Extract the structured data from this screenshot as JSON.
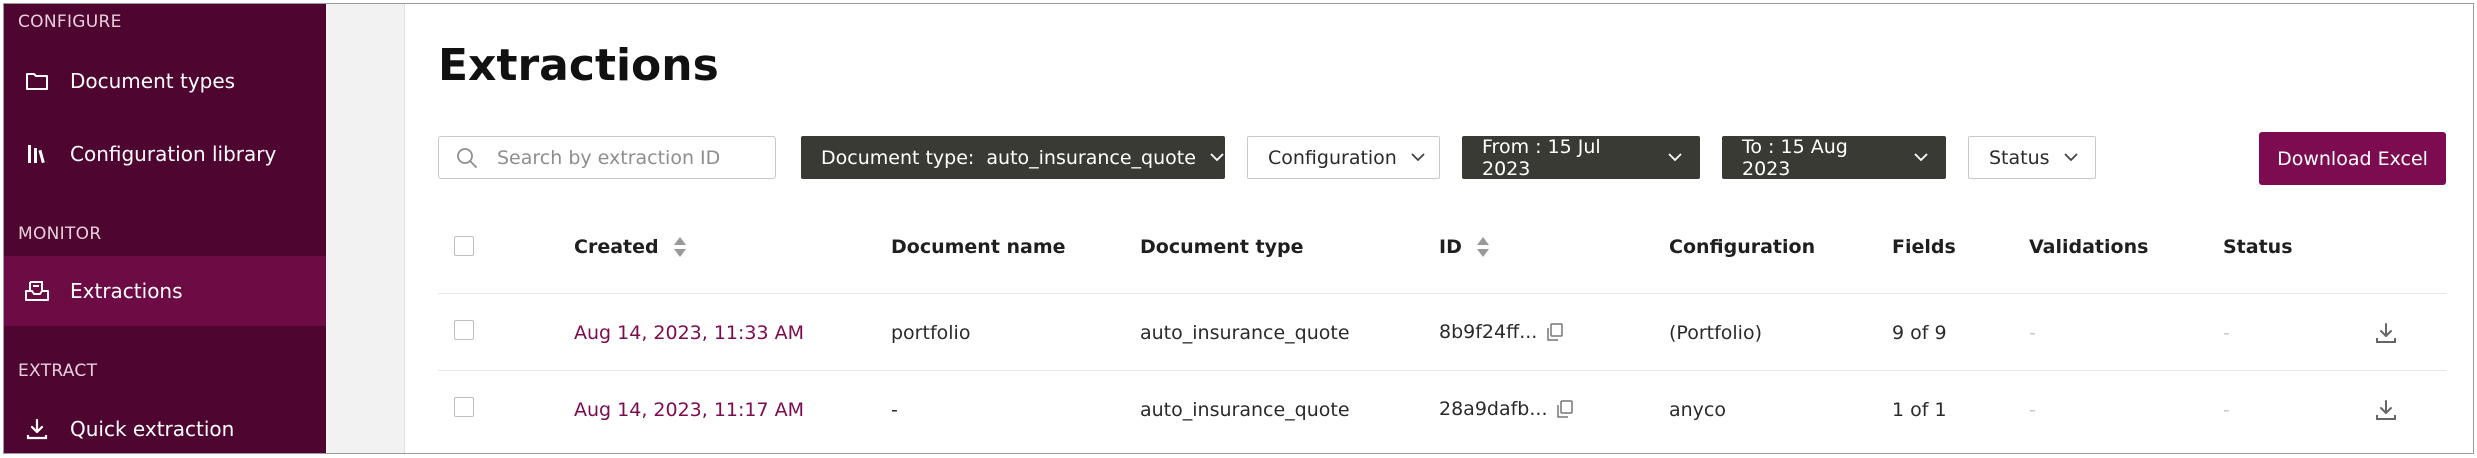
{
  "sidebar": {
    "configure_label": "CONFIGURE",
    "monitor_label": "MONITOR",
    "extract_label": "EXTRACT",
    "items": [
      {
        "label": "Document types",
        "icon": "folder-icon"
      },
      {
        "label": "Configuration library",
        "icon": "library-icon"
      },
      {
        "label": "Extractions",
        "icon": "tray-icon",
        "active": true
      },
      {
        "label": "Quick extraction",
        "icon": "download-icon"
      }
    ],
    "colors": {
      "background": "#4e0631",
      "active": "#6d0b45"
    }
  },
  "main": {
    "title": "Extractions",
    "search": {
      "placeholder": "Search by extraction ID",
      "value": ""
    },
    "filters": {
      "document_type": "Document type:  auto_insurance_quote",
      "configuration": "Configuration",
      "from": "From : 15 Jul 2023",
      "to": "To : 15 Aug 2023",
      "status": "Status"
    },
    "download_label": "Download Excel",
    "accent": "#7c0b4f"
  },
  "table": {
    "headers": {
      "created": "Created",
      "document_name": "Document name",
      "document_type": "Document type",
      "id": "ID",
      "configuration": "Configuration",
      "fields": "Fields",
      "validations": "Validations",
      "status": "Status"
    },
    "rows": [
      {
        "created": "Aug 14, 2023, 11:33 AM",
        "document_name": "portfolio",
        "document_type": "auto_insurance_quote",
        "id": "8b9f24ff...",
        "configuration": "(Portfolio)",
        "fields": "9 of 9",
        "validations": "-",
        "status": "-"
      },
      {
        "created": "Aug 14, 2023, 11:17 AM",
        "document_name": "-",
        "document_type": "auto_insurance_quote",
        "id": "28a9dafb...",
        "configuration": "anyco",
        "fields": "1 of 1",
        "validations": "-",
        "status": "-"
      }
    ]
  }
}
